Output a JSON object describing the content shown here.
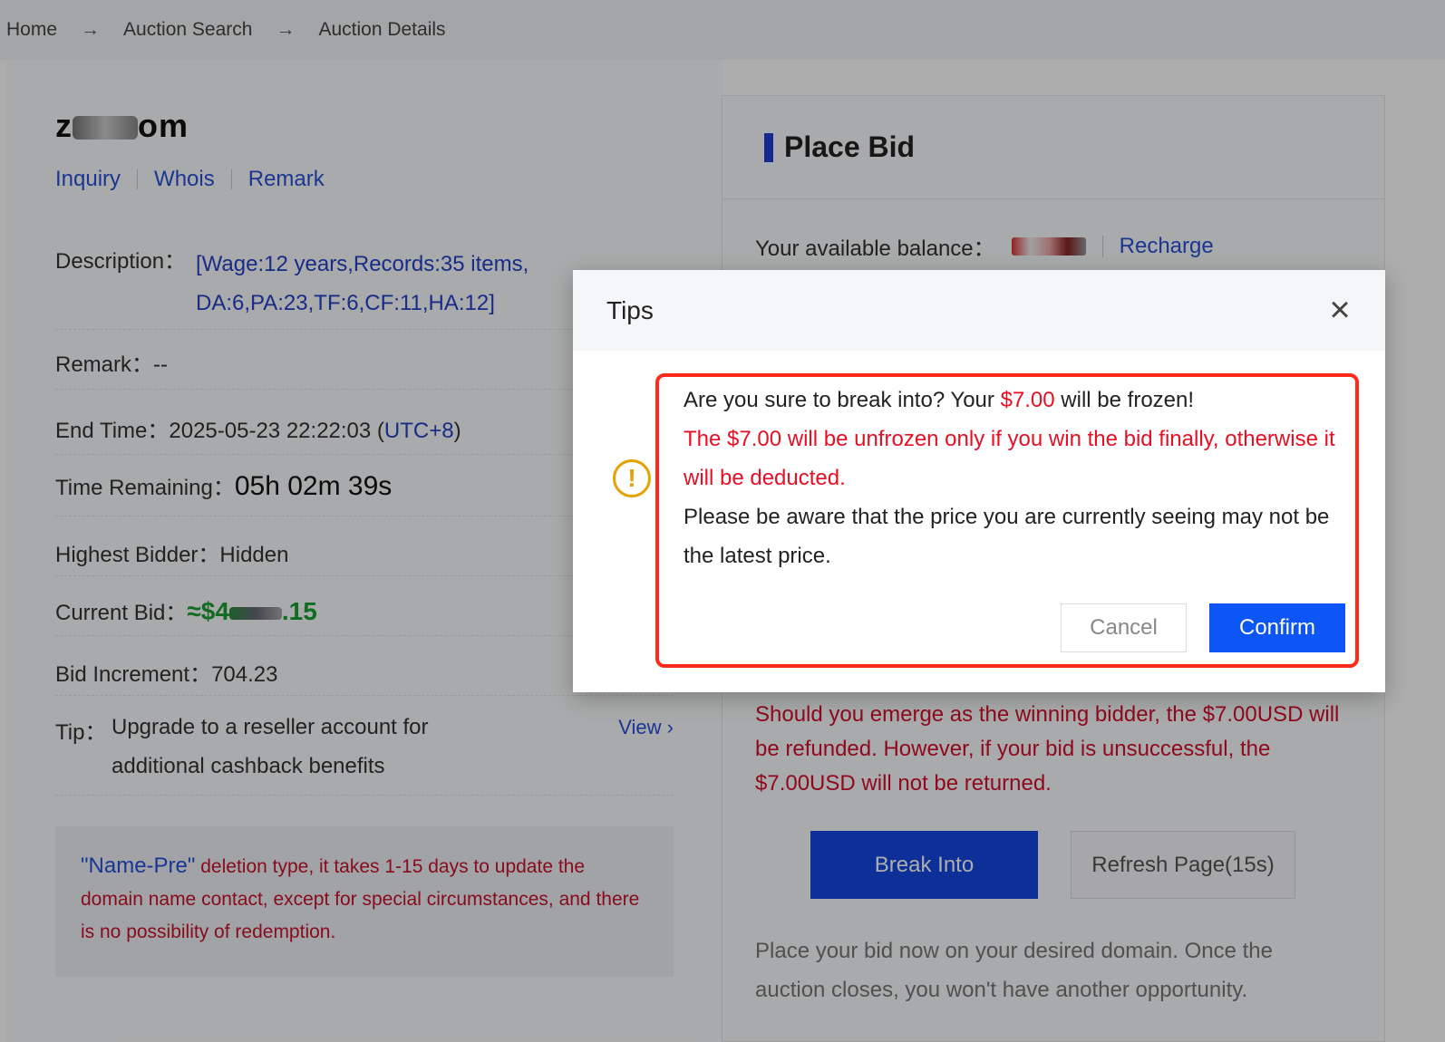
{
  "breadcrumb": {
    "items": [
      "Home",
      "Auction Search",
      "Auction Details"
    ],
    "separator": "→"
  },
  "domain": {
    "prefix": "z",
    "suffix": "om"
  },
  "links": [
    "Inquiry",
    "Whois",
    "Remark"
  ],
  "details": {
    "description_label": "Description：",
    "description_line1": "[Wage:12 years,Records:35 items,",
    "description_line2": "DA:6,PA:23,TF:6,CF:11,HA:12]",
    "remark_label": "Remark：",
    "remark_value": "--",
    "end_time_label": "End Time：",
    "end_time_value": "2025-05-23 22:22:03 (",
    "end_time_tz": "UTC+8",
    "end_time_close": ")",
    "time_remaining_label": "Time Remaining：",
    "time_remaining_value": "05h 02m 39s",
    "highest_bidder_label": "Highest Bidder：",
    "highest_bidder_value": "Hidden",
    "current_bid_label": "Current Bid：",
    "current_bid_prefix": "≈$4",
    "current_bid_suffix": ".15",
    "bid_increment_label": "Bid Increment：",
    "bid_increment_value": "704.23",
    "tip_label": "Tip：",
    "tip_line1": "Upgrade to a reseller account for",
    "tip_line2": "additional cashback benefits",
    "tip_view": "View"
  },
  "notice": {
    "highlight": "\"Name-Pre\"",
    "text": " deletion type, it takes 1-15 days to update the domain name contact, except for special circumstances, and there is no possibility of redemption."
  },
  "bid_panel": {
    "title": "Place Bid",
    "balance_label": "Your available balance：",
    "recharge": "Recharge",
    "warning": "Should you emerge as the winning bidder, the $7.00USD will be refunded. However, if your bid is unsuccessful, the $7.00USD will not be returned.",
    "break_into": "Break Into",
    "refresh": "Refresh Page(15s)",
    "closing": "Place your bid now on your desired domain. Once the auction closes, you won't have another opportunity."
  },
  "modal": {
    "title": "Tips",
    "line1_a": "Are you sure to break into? Your ",
    "line1_amount": "$7.00",
    "line1_b": " will be frozen!",
    "line2": "The $7.00 will be unfrozen only if you win the bid finally, otherwise it will be deducted.",
    "line3": "Please be aware that the price you are currently seeing may not be the latest price.",
    "cancel": "Cancel",
    "confirm": "Confirm"
  },
  "colors": {
    "link_blue": "#2750d8",
    "warning_red": "#e60f24",
    "confirm_blue": "#0d55f5",
    "highlight_border": "#ff2a1a",
    "alert_amber": "#e6a200"
  }
}
